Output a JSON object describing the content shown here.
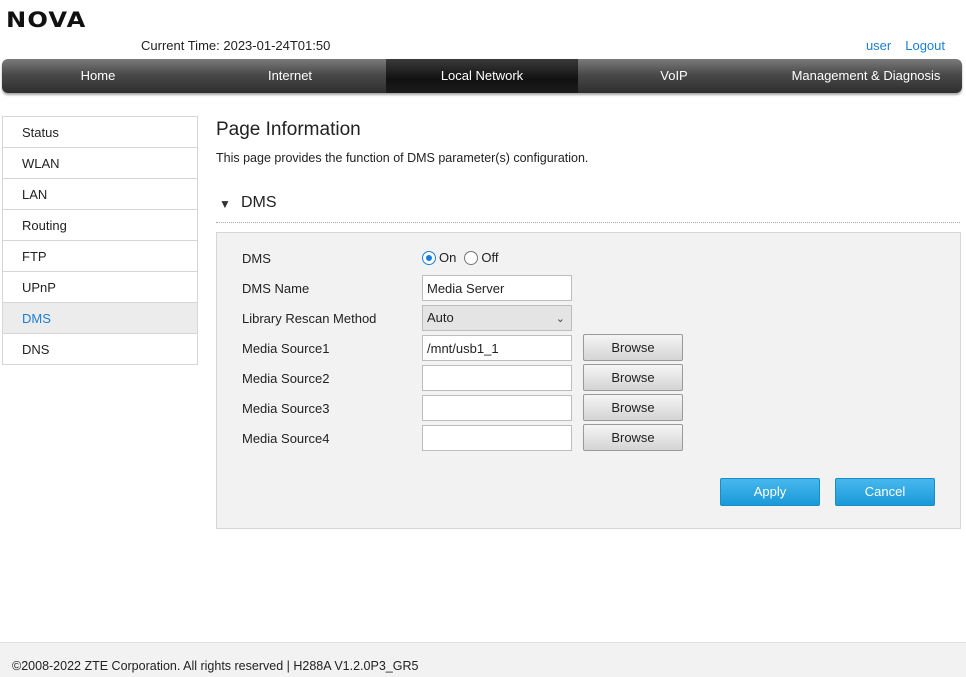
{
  "header": {
    "logo": "NOVA",
    "current_time": "Current Time: 2023-01-24T01:50",
    "user_link": "user",
    "logout_link": "Logout"
  },
  "nav": {
    "tabs": [
      {
        "label": "Home"
      },
      {
        "label": "Internet"
      },
      {
        "label": "Local Network",
        "active": true
      },
      {
        "label": "VoIP"
      },
      {
        "label": "Management & Diagnosis"
      }
    ]
  },
  "sidebar": {
    "items": [
      {
        "label": "Status"
      },
      {
        "label": "WLAN"
      },
      {
        "label": "LAN"
      },
      {
        "label": "Routing"
      },
      {
        "label": "FTP"
      },
      {
        "label": "UPnP"
      },
      {
        "label": "DMS",
        "active": true
      },
      {
        "label": "DNS"
      }
    ]
  },
  "main": {
    "page_title": "Page Information",
    "page_desc": "This page provides the function of DMS parameter(s) configuration.",
    "section_title": "DMS",
    "section_toggle_icon": "triangle-down-icon"
  },
  "form": {
    "dms_label": "DMS",
    "dms_on_label": "On",
    "dms_off_label": "Off",
    "dms_selected": "On",
    "dms_name_label": "DMS Name",
    "dms_name_value": "Media Server",
    "rescan_label": "Library Rescan Method",
    "rescan_value": "Auto",
    "sources": [
      {
        "label": "Media Source1",
        "value": "/mnt/usb1_1"
      },
      {
        "label": "Media Source2",
        "value": ""
      },
      {
        "label": "Media Source3",
        "value": ""
      },
      {
        "label": "Media Source4",
        "value": ""
      }
    ],
    "browse_label": "Browse",
    "apply_label": "Apply",
    "cancel_label": "Cancel"
  },
  "footer": {
    "text": "©2008-2022 ZTE Corporation. All rights reserved  |   H288A V1.2.0P3_GR5"
  },
  "colors": {
    "accent": "#1a7fd4",
    "button_blue": "#2aa6e0",
    "nav_dark": "#2e2e2e"
  }
}
